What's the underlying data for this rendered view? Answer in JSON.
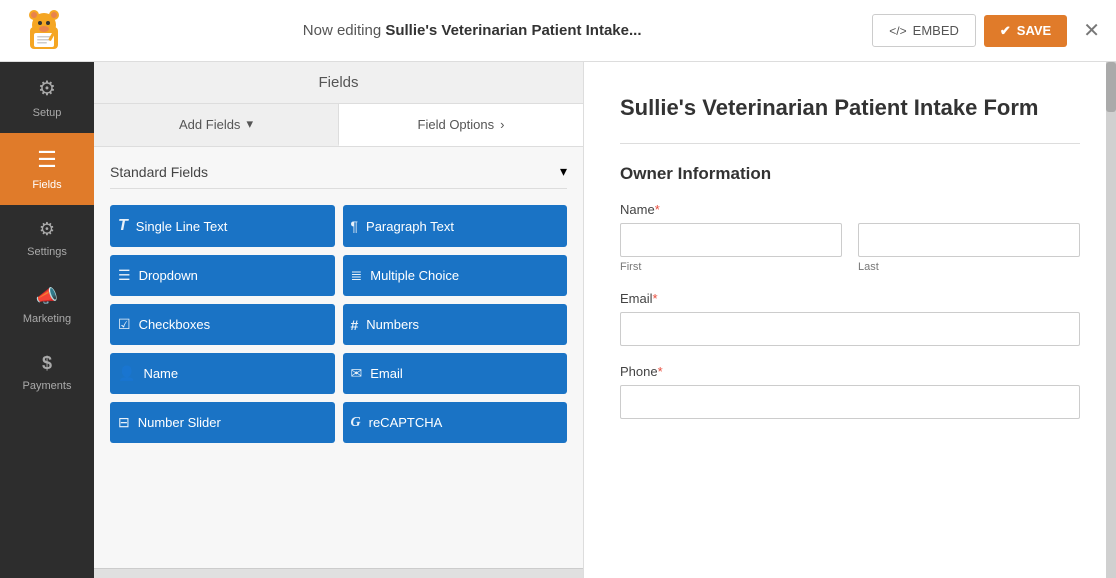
{
  "topbar": {
    "editing_prefix": "Now editing ",
    "form_name": "Sullie's Veterinarian Patient Intake...",
    "embed_label": "EMBED",
    "save_label": "SAVE",
    "close_label": "✕"
  },
  "sidebar": {
    "items": [
      {
        "id": "setup",
        "label": "Setup",
        "icon": "⚙"
      },
      {
        "id": "fields",
        "label": "Fields",
        "icon": "≡",
        "active": true
      },
      {
        "id": "settings",
        "label": "Settings",
        "icon": "⚙"
      },
      {
        "id": "marketing",
        "label": "Marketing",
        "icon": "📢"
      },
      {
        "id": "payments",
        "label": "Payments",
        "icon": "$"
      }
    ]
  },
  "fields_panel": {
    "header": "Fields",
    "tabs": [
      {
        "id": "add-fields",
        "label": "Add Fields",
        "arrow": "▾",
        "active": false
      },
      {
        "id": "field-options",
        "label": "Field Options",
        "arrow": "›",
        "active": true
      }
    ],
    "standard_fields_label": "Standard Fields",
    "field_buttons": [
      {
        "id": "single-line-text",
        "label": "Single Line Text",
        "icon": "T"
      },
      {
        "id": "paragraph-text",
        "label": "Paragraph Text",
        "icon": "¶"
      },
      {
        "id": "dropdown",
        "label": "Dropdown",
        "icon": "☰"
      },
      {
        "id": "multiple-choice",
        "label": "Multiple Choice",
        "icon": "≣"
      },
      {
        "id": "checkboxes",
        "label": "Checkboxes",
        "icon": "☑"
      },
      {
        "id": "numbers",
        "label": "Numbers",
        "icon": "#"
      },
      {
        "id": "name",
        "label": "Name",
        "icon": "👤"
      },
      {
        "id": "email",
        "label": "Email",
        "icon": "✉"
      },
      {
        "id": "number-slider",
        "label": "Number Slider",
        "icon": "⊟"
      },
      {
        "id": "recaptcha",
        "label": "reCAPTCHA",
        "icon": "G"
      }
    ]
  },
  "preview": {
    "form_title": "Sullie's Veterinarian Patient Intake Form",
    "section_label": "Owner Information",
    "fields": [
      {
        "id": "name",
        "label": "Name",
        "required": true,
        "type": "name",
        "sub_fields": [
          {
            "placeholder": "",
            "sub_label": "First"
          },
          {
            "placeholder": "",
            "sub_label": "Last"
          }
        ]
      },
      {
        "id": "email",
        "label": "Email",
        "required": true,
        "type": "text"
      },
      {
        "id": "phone",
        "label": "Phone",
        "required": true,
        "type": "text"
      }
    ]
  }
}
